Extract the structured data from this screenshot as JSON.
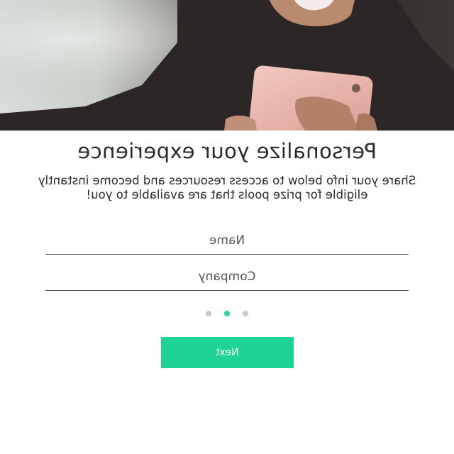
{
  "hero": {
    "image": "woman-holding-rose-gold-smartphone"
  },
  "form": {
    "title": "Personalize your experience",
    "subtitle": "Share your info below to access resources and become instantly eligible for prize pools that are available to you!",
    "name_placeholder": "Name",
    "company_placeholder": "Company",
    "next_label": "Next"
  },
  "pagination": {
    "total": 3,
    "active_index": 1,
    "active_color": "#2bd19a",
    "inactive_color": "#c8c8c8"
  },
  "colors": {
    "accent": "#1fd394"
  }
}
